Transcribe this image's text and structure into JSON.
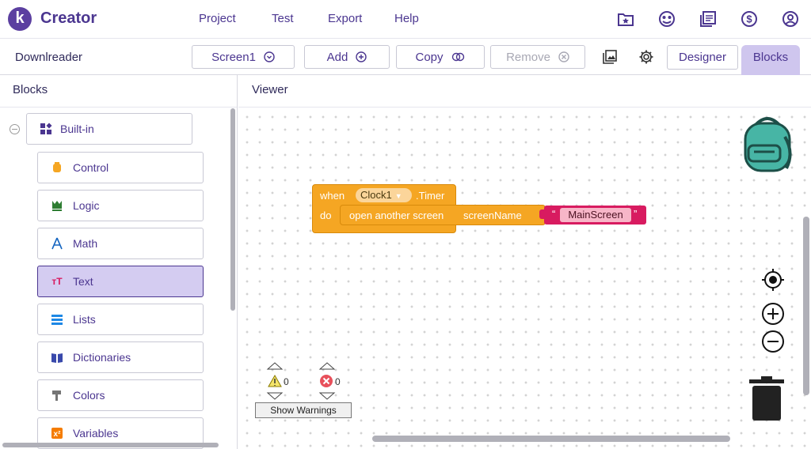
{
  "app": {
    "logo_letter": "k",
    "name": "Creator",
    "brand_color": "#5b3fa0"
  },
  "menu": {
    "items": [
      "Project",
      "Test",
      "Export",
      "Help"
    ]
  },
  "top_icons": [
    "folder-star-icon",
    "gallery-icon",
    "library-icon",
    "dollar-icon",
    "account-icon"
  ],
  "toolbar": {
    "project_name": "Downlreader",
    "screen_label": "Screen1",
    "add_label": "Add",
    "copy_label": "Copy",
    "remove_label": "Remove",
    "designer_label": "Designer",
    "blocks_label": "Blocks"
  },
  "left_panel": {
    "title": "Blocks",
    "builtin_label": "Built-in",
    "categories": [
      {
        "label": "Control",
        "icon": "control-icon",
        "color": "#f5a623"
      },
      {
        "label": "Logic",
        "icon": "logic-icon",
        "color": "#2e7d32"
      },
      {
        "label": "Math",
        "icon": "math-icon",
        "color": "#1565c0"
      },
      {
        "label": "Text",
        "icon": "text-icon",
        "color": "#d81b60",
        "selected": true
      },
      {
        "label": "Lists",
        "icon": "lists-icon",
        "color": "#1e88e5"
      },
      {
        "label": "Dictionaries",
        "icon": "dictionaries-icon",
        "color": "#3949ab"
      },
      {
        "label": "Colors",
        "icon": "colors-icon",
        "color": "#757575"
      },
      {
        "label": "Variables",
        "icon": "variables-icon",
        "color": "#f57c00"
      }
    ]
  },
  "viewer": {
    "title": "Viewer",
    "event_block": {
      "when": "when",
      "component": "Clock1",
      "event": ".Timer",
      "do": "do"
    },
    "call_block": {
      "method": "open another screen",
      "param": "screenName"
    },
    "text_block": {
      "open_quote": "“",
      "value": "MainScreen",
      "close_quote": "”"
    },
    "warnings": {
      "warning_count": "0",
      "error_count": "0",
      "show_warnings_label": "Show Warnings"
    }
  }
}
